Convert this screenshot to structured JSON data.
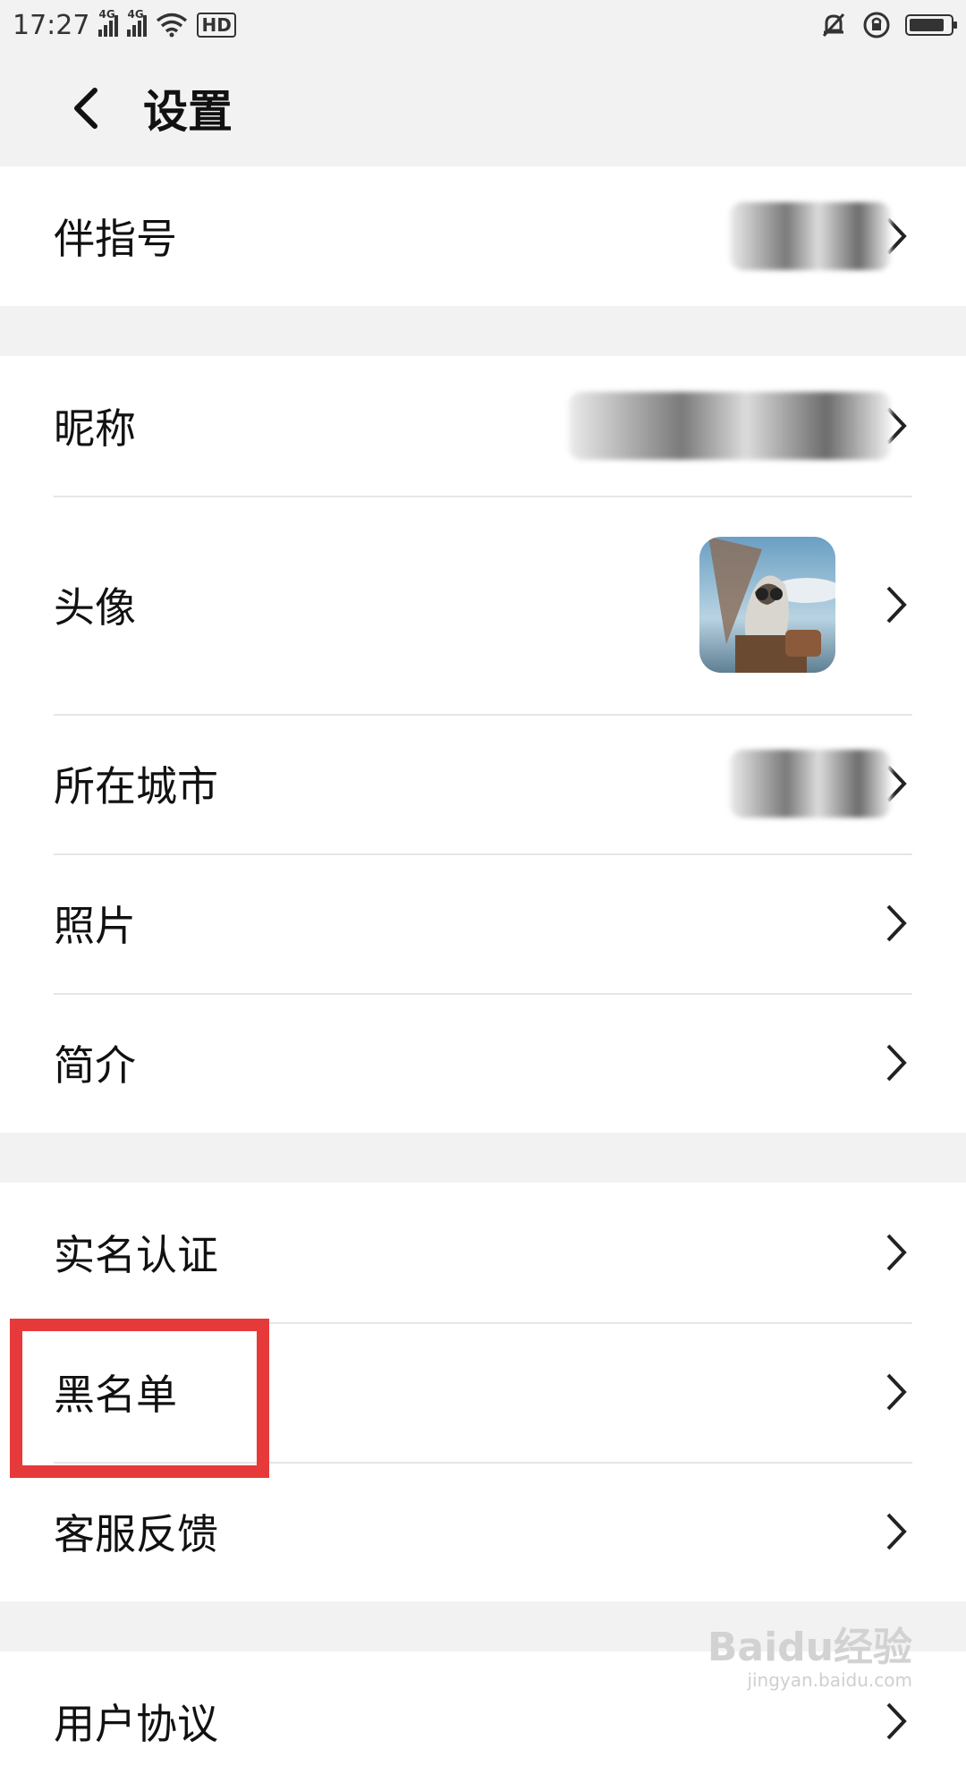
{
  "status_bar": {
    "time": "17:27",
    "network_1": "4G",
    "network_2": "4G",
    "hd": "HD"
  },
  "header": {
    "title": "设置"
  },
  "group1": [
    {
      "label": "伴指号"
    }
  ],
  "group2": [
    {
      "label": "昵称"
    },
    {
      "label": "头像"
    },
    {
      "label": "所在城市"
    },
    {
      "label": "照片"
    },
    {
      "label": "简介"
    }
  ],
  "group3": [
    {
      "label": "实名认证"
    },
    {
      "label": "黑名单"
    },
    {
      "label": "客服反馈"
    }
  ],
  "group4": [
    {
      "label": "用户协议"
    }
  ],
  "watermark": {
    "brand": "Baidu经验",
    "url": "jingyan.baidu.com"
  },
  "colors": {
    "highlight": "#e63a3a",
    "background": "#f2f2f2",
    "row_bg": "#ffffff"
  }
}
